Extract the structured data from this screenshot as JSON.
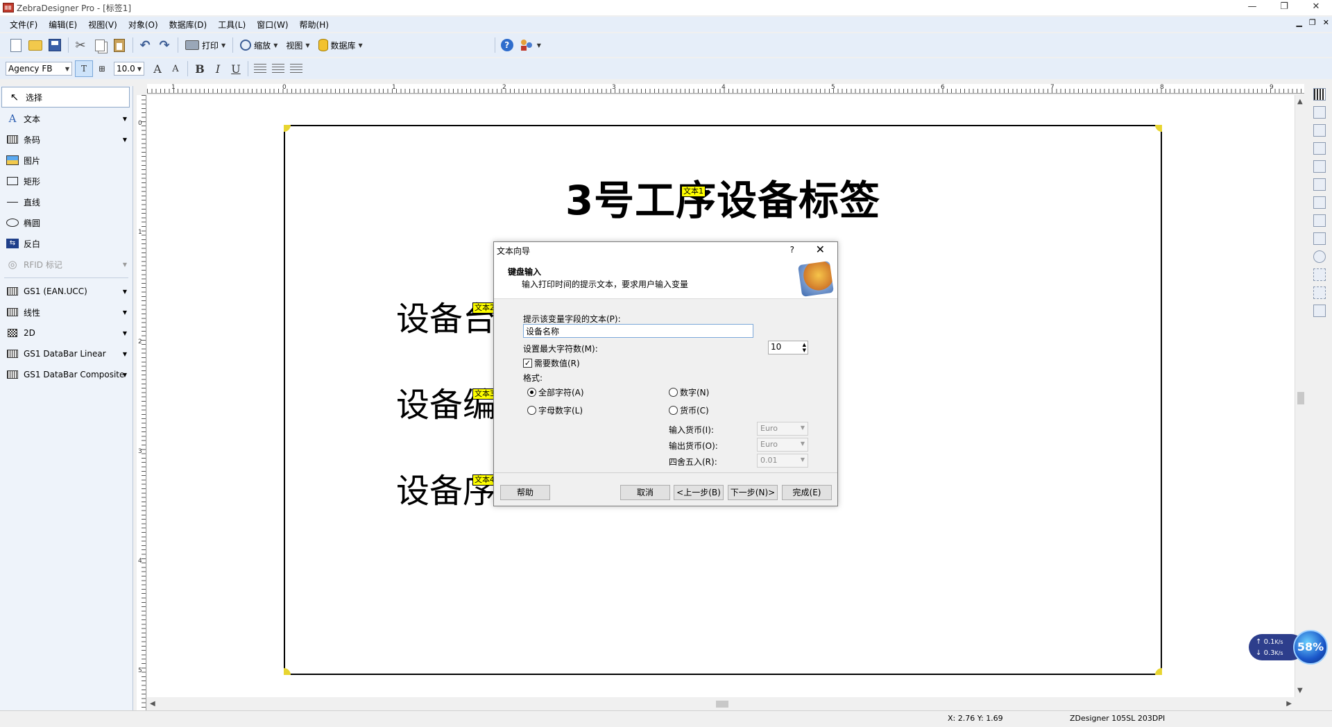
{
  "window": {
    "title": "ZebraDesigner Pro - [标签1]",
    "controls": [
      "—",
      "❐",
      "✕"
    ],
    "mdi_controls": [
      "▁",
      "❐",
      "✕"
    ]
  },
  "menu": [
    "文件(F)",
    "编辑(E)",
    "视图(V)",
    "对象(O)",
    "数据库(D)",
    "工具(L)",
    "窗口(W)",
    "帮助(H)"
  ],
  "toolbar": {
    "print": "打印",
    "zoom": "缩放",
    "view": "视图",
    "database": "数据库"
  },
  "format_bar": {
    "font": "Agency FB",
    "size": "10.0",
    "bold": "B",
    "italic": "I",
    "underline": "U"
  },
  "tools": [
    {
      "label": "选择",
      "icon": "cursor-icon",
      "arrow": false,
      "selected": true
    },
    {
      "label": "文本",
      "icon": "text-icon",
      "arrow": true
    },
    {
      "label": "条码",
      "icon": "barcode-icon",
      "arrow": true
    },
    {
      "label": "图片",
      "icon": "picture-icon",
      "arrow": false
    },
    {
      "label": "矩形",
      "icon": "rectangle-icon",
      "arrow": false
    },
    {
      "label": "直线",
      "icon": "line-icon",
      "arrow": false
    },
    {
      "label": "椭圆",
      "icon": "ellipse-icon",
      "arrow": false
    },
    {
      "label": "反白",
      "icon": "inverse-icon",
      "arrow": false
    },
    {
      "label": "RFID 标记",
      "icon": "rfid-icon",
      "arrow": true,
      "disabled": true
    }
  ],
  "barcode_tools": [
    {
      "label": "GS1 (EAN.UCC)"
    },
    {
      "label": "线性"
    },
    {
      "label": "2D"
    },
    {
      "label": "GS1 DataBar Linear"
    },
    {
      "label": "GS1 DataBar Composite"
    }
  ],
  "ruler": {
    "h_ticks": [
      "1",
      "0",
      "1",
      "2",
      "3",
      "4",
      "5",
      "6",
      "7",
      "8",
      "9"
    ],
    "v_ticks": [
      "0",
      "1",
      "2",
      "3",
      "4",
      "5"
    ]
  },
  "label": {
    "title": "3号工序设备标签",
    "title_tag": "文本1",
    "rows": [
      {
        "text": "设备台",
        "tag": "文本2"
      },
      {
        "text": "设备编",
        "tag": "文本3"
      },
      {
        "text": "设备序",
        "tag": "文本4"
      }
    ]
  },
  "dialog": {
    "title": "文本向导",
    "help_glyph": "?",
    "close_glyph": "✕",
    "heading": "键盘输入",
    "subheading": "输入打印时间的提示文本，要求用户输入变量",
    "prompt_label": "提示该变量字段的文本(P):",
    "prompt_value": "设备名称",
    "max_chars_label": "设置最大字符数(M):",
    "max_chars_value": "10",
    "require_value_label": "需要数值(R)",
    "require_value_checked": true,
    "format_label": "格式:",
    "formats": [
      {
        "label": "全部字符(A)",
        "checked": true
      },
      {
        "label": "数字(N)",
        "checked": false
      },
      {
        "label": "字母数字(L)",
        "checked": false
      },
      {
        "label": "货币(C)",
        "checked": false
      }
    ],
    "input_currency_label": "输入货币(I):",
    "input_currency_value": "Euro",
    "output_currency_label": "输出货币(O):",
    "output_currency_value": "Euro",
    "rounding_label": "四舍五入(R):",
    "rounding_value": "0.01",
    "buttons": {
      "help": "帮助",
      "cancel": "取消",
      "back": "<上一步(B)",
      "next": "下一步(N)>",
      "finish": "完成(E)"
    }
  },
  "status": {
    "coords": "X:  2.76 Y:  1.69",
    "printer": "ZDesigner 105SL 203DPI"
  },
  "network": {
    "up": "0.1",
    "up_unit": "K/s",
    "down": "0.3",
    "down_unit": "K/s",
    "percent": "58%"
  }
}
